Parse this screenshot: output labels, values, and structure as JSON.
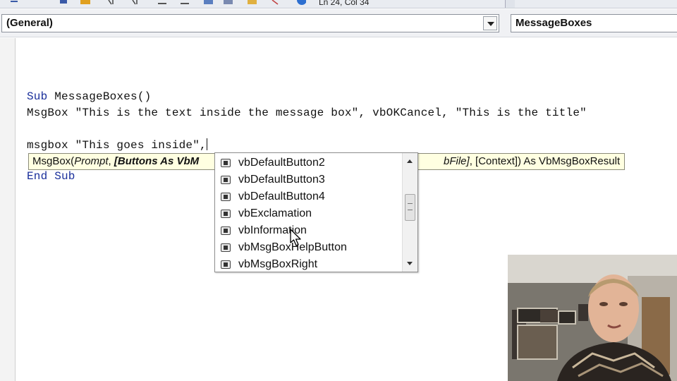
{
  "toolbar": {
    "position_text": "Ln 24, Col 34",
    "icons": [
      "indent-icon",
      "outdent-icon",
      "comment-icon",
      "uncomment-icon",
      "bookmark-icon",
      "object-browser-icon",
      "help-icon"
    ]
  },
  "combos": {
    "object": "(General)",
    "procedure": "MessageBoxes"
  },
  "code": {
    "line1_kw": "Sub",
    "line1_rest": " MessageBoxes()",
    "line2": "MsgBox \"This is the text inside the message box\", vbOKCancel, \"This is the title\"",
    "line3": "msgbox \"This goes inside\",",
    "line4": "End Sub"
  },
  "tooltip": {
    "func": "MsgBox(",
    "prompt": "Prompt",
    "sep": ", ",
    "buttons": "[Buttons As VbM",
    "tail_file": "bFile]",
    "tail_rest": ", [Context]) As VbMsgBoxResult"
  },
  "intellisense": {
    "items": [
      "vbDefaultButton2",
      "vbDefaultButton3",
      "vbDefaultButton4",
      "vbExclamation",
      "vbInformation",
      "vbMsgBoxHelpButton",
      "vbMsgBoxRight"
    ],
    "scroll_position": 0.4
  }
}
